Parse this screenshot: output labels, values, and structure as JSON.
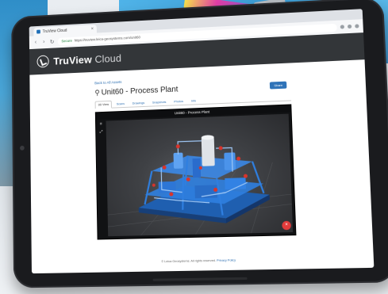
{
  "browser": {
    "tab_title": "TruView Cloud",
    "tab_close": "×",
    "url_secure": "Secure",
    "url": "https://truview.leica-geosystems.com/unit60"
  },
  "app": {
    "brand_strong": "TruView",
    "brand_light": "Cloud"
  },
  "page": {
    "back_link": "Back to All Assets",
    "title": "Unit60 - Process Plant",
    "share_label": "Share",
    "tabs": [
      {
        "label": "3D View",
        "active": true
      },
      {
        "label": "Scans",
        "active": false
      },
      {
        "label": "Drawings",
        "active": false
      },
      {
        "label": "Snapshots",
        "active": false
      },
      {
        "label": "Photos",
        "active": false
      },
      {
        "label": "Info",
        "active": false
      }
    ]
  },
  "viewer": {
    "title": "Unit60 - Process Plant",
    "menu_icon": "≡",
    "expand_icon": "⤢",
    "close_icon": "×"
  },
  "footer": {
    "text": "© Leica Geosystems. All rights reserved.",
    "link": "Privacy Policy"
  },
  "colors": {
    "equipment_blue": "#2f7fe0",
    "valve_red": "#d9342b",
    "app_header": "#333639"
  }
}
